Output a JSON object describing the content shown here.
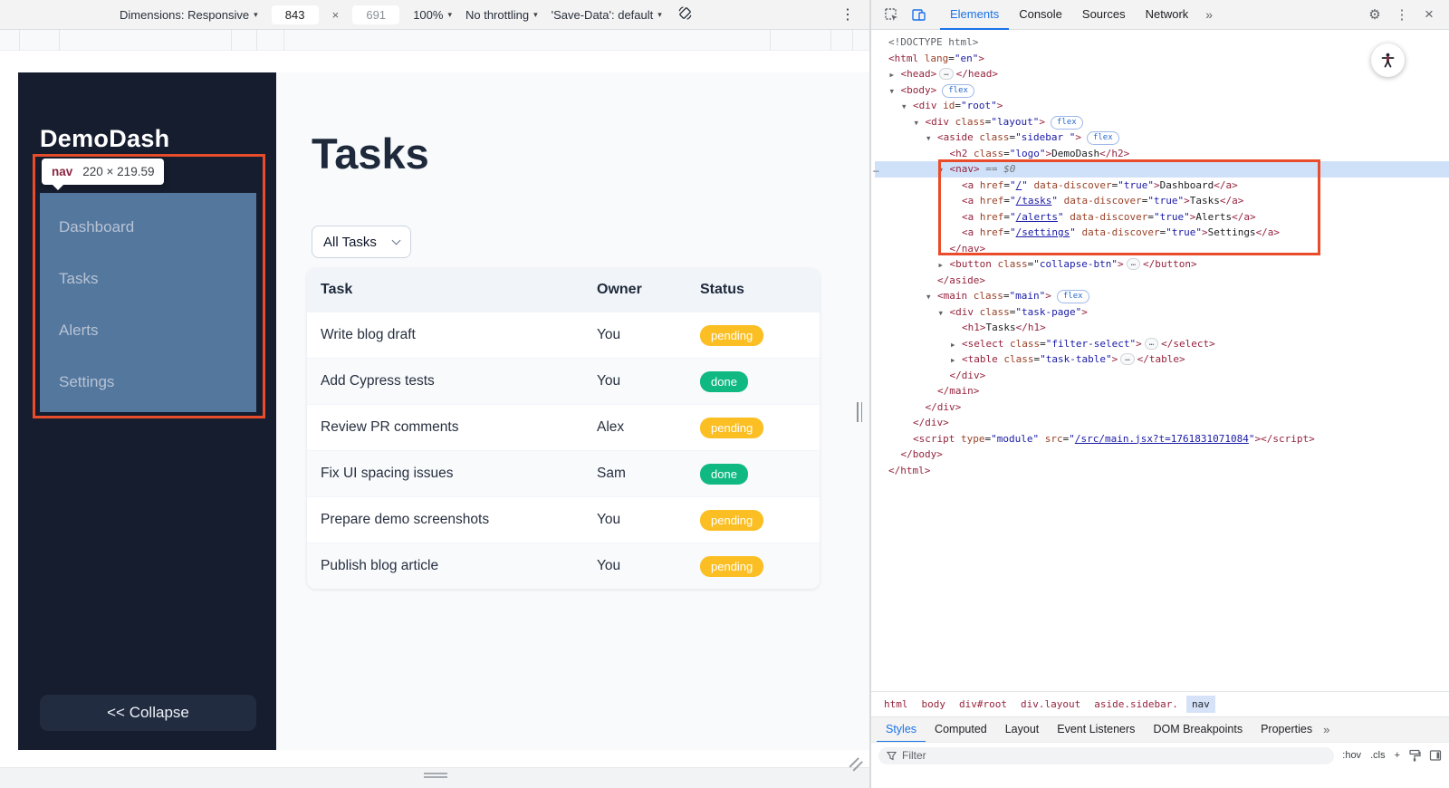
{
  "colors": {
    "accent_blue": "#1a73e8",
    "highlight_orange": "#e94c2b",
    "inspect_overlay_blue": "#54779e",
    "status_pending": "#fbbf24",
    "status_done": "#10b981"
  },
  "icons": {
    "caret_down": "▾",
    "more_tabs": "»",
    "gear": "⚙",
    "kebab": "⋮",
    "close": "×",
    "ellipsis": "…",
    "arrow_expanded": "▼",
    "arrow_collapsed": "▶"
  },
  "device_toolbar": {
    "dimensions_label": "Dimensions: Responsive",
    "width_value": "843",
    "multiply": "×",
    "height_value": "691",
    "zoom_value": "100%",
    "throttling_value": "No throttling",
    "save_data_value": "'Save-Data': default"
  },
  "page": {
    "sidebar": {
      "logo": "DemoDash",
      "nav_items": [
        "Dashboard",
        "Tasks",
        "Alerts",
        "Settings"
      ],
      "collapse_label": "<< Collapse"
    },
    "inspect_tooltip": {
      "tag": "nav",
      "dims": "220 × 219.59"
    },
    "main": {
      "title": "Tasks",
      "filter_value": "All Tasks",
      "table": {
        "headers": [
          "Task",
          "Owner",
          "Status"
        ],
        "rows": [
          {
            "task": "Write blog draft",
            "owner": "You",
            "status": "pending"
          },
          {
            "task": "Add Cypress tests",
            "owner": "You",
            "status": "done"
          },
          {
            "task": "Review PR comments",
            "owner": "Alex",
            "status": "pending"
          },
          {
            "task": "Fix UI spacing issues",
            "owner": "Sam",
            "status": "done"
          },
          {
            "task": "Prepare demo screenshots",
            "owner": "You",
            "status": "pending"
          },
          {
            "task": "Publish blog article",
            "owner": "You",
            "status": "pending"
          }
        ]
      }
    }
  },
  "devtools": {
    "tabs": [
      {
        "label": "Elements",
        "active": true
      },
      {
        "label": "Console",
        "active": false
      },
      {
        "label": "Sources",
        "active": false
      },
      {
        "label": "Network",
        "active": false
      }
    ],
    "badge_flex": "flex",
    "code_lines": [
      {
        "indent": 0,
        "tokens": [
          {
            "c": "doc",
            "s": "<!DOCTYPE html>"
          }
        ]
      },
      {
        "indent": 0,
        "tokens": [
          {
            "c": "tag",
            "s": "<html "
          },
          {
            "c": "attr",
            "s": "lang"
          },
          {
            "c": "pun",
            "s": "="
          },
          {
            "c": "val",
            "s": "\"en\""
          },
          {
            "c": "tag",
            "s": ">"
          }
        ]
      },
      {
        "indent": 1,
        "arrow": "collapsed",
        "tokens": [
          {
            "c": "tag",
            "s": "<head>"
          },
          {
            "c": "dots"
          },
          {
            "c": "tag",
            "s": "</head>"
          }
        ]
      },
      {
        "indent": 1,
        "arrow": "expanded",
        "tokens": [
          {
            "c": "tag",
            "s": "<body>"
          },
          {
            "c": "flex"
          }
        ]
      },
      {
        "indent": 2,
        "arrow": "expanded",
        "tokens": [
          {
            "c": "tag",
            "s": "<div "
          },
          {
            "c": "attr",
            "s": "id"
          },
          {
            "c": "pun",
            "s": "="
          },
          {
            "c": "val",
            "s": "\"root\""
          },
          {
            "c": "tag",
            "s": ">"
          }
        ]
      },
      {
        "indent": 3,
        "arrow": "expanded",
        "tokens": [
          {
            "c": "tag",
            "s": "<div "
          },
          {
            "c": "attr",
            "s": "class"
          },
          {
            "c": "pun",
            "s": "="
          },
          {
            "c": "val",
            "s": "\"layout\""
          },
          {
            "c": "tag",
            "s": ">"
          },
          {
            "c": "flex"
          }
        ]
      },
      {
        "indent": 4,
        "arrow": "expanded",
        "tokens": [
          {
            "c": "tag",
            "s": "<aside "
          },
          {
            "c": "attr",
            "s": "class"
          },
          {
            "c": "pun",
            "s": "="
          },
          {
            "c": "val",
            "s": "\"sidebar \""
          },
          {
            "c": "tag",
            "s": ">"
          },
          {
            "c": "flex"
          }
        ]
      },
      {
        "indent": 5,
        "tokens": [
          {
            "c": "tag",
            "s": "<h2 "
          },
          {
            "c": "attr",
            "s": "class"
          },
          {
            "c": "pun",
            "s": "="
          },
          {
            "c": "val",
            "s": "\"logo\""
          },
          {
            "c": "tag",
            "s": ">"
          },
          {
            "c": "txt",
            "s": "DemoDash"
          },
          {
            "c": "tag",
            "s": "</h2>"
          }
        ]
      },
      {
        "indent": 5,
        "arrow": "expanded",
        "selected": true,
        "gutter": true,
        "tokens": [
          {
            "c": "tag",
            "s": "<nav>"
          },
          {
            "c": "meta",
            "s": " == $0"
          }
        ]
      },
      {
        "indent": 6,
        "tokens": [
          {
            "c": "tag",
            "s": "<a "
          },
          {
            "c": "attr",
            "s": "href"
          },
          {
            "c": "pun",
            "s": "="
          },
          {
            "c": "val",
            "s": "\""
          },
          {
            "c": "link",
            "s": "/"
          },
          {
            "c": "val",
            "s": "\""
          },
          {
            "c": "attr",
            "s": " data-discover"
          },
          {
            "c": "pun",
            "s": "="
          },
          {
            "c": "val",
            "s": "\"true\""
          },
          {
            "c": "tag",
            "s": ">"
          },
          {
            "c": "txt",
            "s": "Dashboard"
          },
          {
            "c": "tag",
            "s": "</a>"
          }
        ]
      },
      {
        "indent": 6,
        "tokens": [
          {
            "c": "tag",
            "s": "<a "
          },
          {
            "c": "attr",
            "s": "href"
          },
          {
            "c": "pun",
            "s": "="
          },
          {
            "c": "val",
            "s": "\""
          },
          {
            "c": "link",
            "s": "/tasks"
          },
          {
            "c": "val",
            "s": "\""
          },
          {
            "c": "attr",
            "s": " data-discover"
          },
          {
            "c": "pun",
            "s": "="
          },
          {
            "c": "val",
            "s": "\"true\""
          },
          {
            "c": "tag",
            "s": ">"
          },
          {
            "c": "txt",
            "s": "Tasks"
          },
          {
            "c": "tag",
            "s": "</a>"
          }
        ]
      },
      {
        "indent": 6,
        "tokens": [
          {
            "c": "tag",
            "s": "<a "
          },
          {
            "c": "attr",
            "s": "href"
          },
          {
            "c": "pun",
            "s": "="
          },
          {
            "c": "val",
            "s": "\""
          },
          {
            "c": "link",
            "s": "/alerts"
          },
          {
            "c": "val",
            "s": "\""
          },
          {
            "c": "attr",
            "s": " data-discover"
          },
          {
            "c": "pun",
            "s": "="
          },
          {
            "c": "val",
            "s": "\"true\""
          },
          {
            "c": "tag",
            "s": ">"
          },
          {
            "c": "txt",
            "s": "Alerts"
          },
          {
            "c": "tag",
            "s": "</a>"
          }
        ]
      },
      {
        "indent": 6,
        "tokens": [
          {
            "c": "tag",
            "s": "<a "
          },
          {
            "c": "attr",
            "s": "href"
          },
          {
            "c": "pun",
            "s": "="
          },
          {
            "c": "val",
            "s": "\""
          },
          {
            "c": "link",
            "s": "/settings"
          },
          {
            "c": "val",
            "s": "\""
          },
          {
            "c": "attr",
            "s": " data-discover"
          },
          {
            "c": "pun",
            "s": "="
          },
          {
            "c": "val",
            "s": "\"true\""
          },
          {
            "c": "tag",
            "s": ">"
          },
          {
            "c": "txt",
            "s": "Settings"
          },
          {
            "c": "tag",
            "s": "</a>"
          }
        ]
      },
      {
        "indent": 5,
        "tokens": [
          {
            "c": "tag",
            "s": "</nav>"
          }
        ]
      },
      {
        "indent": 5,
        "arrow": "collapsed",
        "tokens": [
          {
            "c": "tag",
            "s": "<button "
          },
          {
            "c": "attr",
            "s": "class"
          },
          {
            "c": "pun",
            "s": "="
          },
          {
            "c": "val",
            "s": "\"collapse-btn\""
          },
          {
            "c": "tag",
            "s": ">"
          },
          {
            "c": "dots"
          },
          {
            "c": "tag",
            "s": "</button>"
          }
        ]
      },
      {
        "indent": 4,
        "tokens": [
          {
            "c": "tag",
            "s": "</aside>"
          }
        ]
      },
      {
        "indent": 4,
        "arrow": "expanded",
        "tokens": [
          {
            "c": "tag",
            "s": "<main "
          },
          {
            "c": "attr",
            "s": "class"
          },
          {
            "c": "pun",
            "s": "="
          },
          {
            "c": "val",
            "s": "\"main\""
          },
          {
            "c": "tag",
            "s": ">"
          },
          {
            "c": "flex"
          }
        ]
      },
      {
        "indent": 5,
        "arrow": "expanded",
        "tokens": [
          {
            "c": "tag",
            "s": "<div "
          },
          {
            "c": "attr",
            "s": "class"
          },
          {
            "c": "pun",
            "s": "="
          },
          {
            "c": "val",
            "s": "\"task-page\""
          },
          {
            "c": "tag",
            "s": ">"
          }
        ]
      },
      {
        "indent": 6,
        "tokens": [
          {
            "c": "tag",
            "s": "<h1>"
          },
          {
            "c": "txt",
            "s": "Tasks"
          },
          {
            "c": "tag",
            "s": "</h1>"
          }
        ]
      },
      {
        "indent": 6,
        "arrow": "collapsed",
        "tokens": [
          {
            "c": "tag",
            "s": "<select "
          },
          {
            "c": "attr",
            "s": "class"
          },
          {
            "c": "pun",
            "s": "="
          },
          {
            "c": "val",
            "s": "\"filter-select\""
          },
          {
            "c": "tag",
            "s": ">"
          },
          {
            "c": "dots"
          },
          {
            "c": "tag",
            "s": "</select>"
          }
        ]
      },
      {
        "indent": 6,
        "arrow": "collapsed",
        "tokens": [
          {
            "c": "tag",
            "s": "<table "
          },
          {
            "c": "attr",
            "s": "class"
          },
          {
            "c": "pun",
            "s": "="
          },
          {
            "c": "val",
            "s": "\"task-table\""
          },
          {
            "c": "tag",
            "s": ">"
          },
          {
            "c": "dots"
          },
          {
            "c": "tag",
            "s": "</table>"
          }
        ]
      },
      {
        "indent": 5,
        "tokens": [
          {
            "c": "tag",
            "s": "</div>"
          }
        ]
      },
      {
        "indent": 4,
        "tokens": [
          {
            "c": "tag",
            "s": "</main>"
          }
        ]
      },
      {
        "indent": 3,
        "tokens": [
          {
            "c": "tag",
            "s": "</div>"
          }
        ]
      },
      {
        "indent": 2,
        "tokens": [
          {
            "c": "tag",
            "s": "</div>"
          }
        ]
      },
      {
        "indent": 2,
        "tokens": [
          {
            "c": "tag",
            "s": "<script "
          },
          {
            "c": "attr",
            "s": "type"
          },
          {
            "c": "pun",
            "s": "="
          },
          {
            "c": "val",
            "s": "\"module\""
          },
          {
            "c": "attr",
            "s": " src"
          },
          {
            "c": "pun",
            "s": "="
          },
          {
            "c": "val",
            "s": "\""
          },
          {
            "c": "link",
            "s": "/src/main.jsx?t=1761831071084"
          },
          {
            "c": "val",
            "s": "\""
          },
          {
            "c": "tag",
            "s": "></script>"
          }
        ]
      },
      {
        "indent": 1,
        "tokens": [
          {
            "c": "tag",
            "s": "</body>"
          }
        ]
      },
      {
        "indent": 0,
        "tokens": [
          {
            "c": "tag",
            "s": "</html>"
          }
        ]
      }
    ],
    "breadcrumbs": [
      {
        "label": "html",
        "selected": false
      },
      {
        "label": "body",
        "selected": false
      },
      {
        "label": "div#root",
        "selected": false
      },
      {
        "label": "div.layout",
        "selected": false
      },
      {
        "label": "aside.sidebar.",
        "selected": false
      },
      {
        "label": "nav",
        "selected": true
      }
    ],
    "panel_tabs": [
      {
        "label": "Styles",
        "active": true
      },
      {
        "label": "Computed",
        "active": false
      },
      {
        "label": "Layout",
        "active": false
      },
      {
        "label": "Event Listeners",
        "active": false
      },
      {
        "label": "DOM Breakpoints",
        "active": false
      },
      {
        "label": "Properties",
        "active": false
      }
    ],
    "styles_filter_placeholder": "Filter",
    "style_controls": [
      ":hov",
      ".cls",
      "+"
    ]
  }
}
